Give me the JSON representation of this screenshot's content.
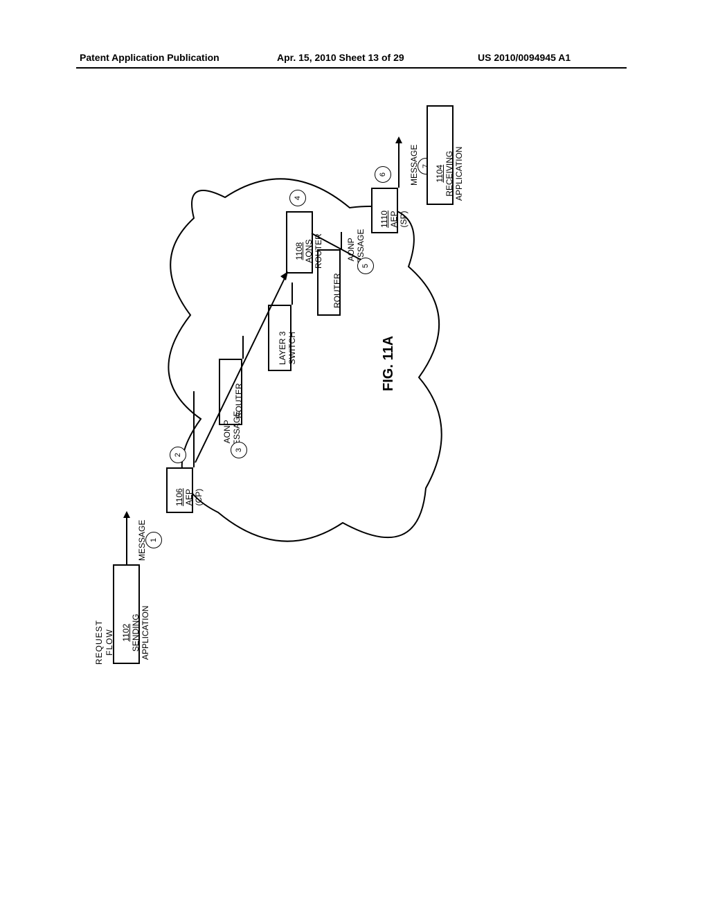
{
  "header": {
    "left": "Patent Application Publication",
    "center": "Apr. 15, 2010  Sheet 13 of 29",
    "right": "US 2010/0094945 A1"
  },
  "fig_label": "FIG. 11A",
  "flow_label": "REQUEST\nFLOW",
  "blocks": {
    "sending": {
      "ref": "1102",
      "line2": "SENDING",
      "line3": "APPLICATION"
    },
    "aep_cp": {
      "ref": "1106",
      "line2": "AEP",
      "line3": "(CP)"
    },
    "router1": {
      "label": "ROUTER"
    },
    "switch": {
      "line1": "LAYER 3",
      "line2": "SWITCH"
    },
    "router2": {
      "label": "ROUTER"
    },
    "aons": {
      "ref": "1108",
      "line2": "AONS",
      "line3": "ROUTER"
    },
    "aep_sp": {
      "ref": "1110",
      "line2": "AEP",
      "line3": "(SP)"
    },
    "receiving": {
      "ref": "1104",
      "line2": "RECEIVING",
      "line3": "APPLICATION"
    }
  },
  "labels": {
    "message": "MESSAGE",
    "aonp_message": "AONP\nMESSAGE"
  },
  "steps": [
    "1",
    "2",
    "3",
    "4",
    "5",
    "6",
    "7"
  ]
}
